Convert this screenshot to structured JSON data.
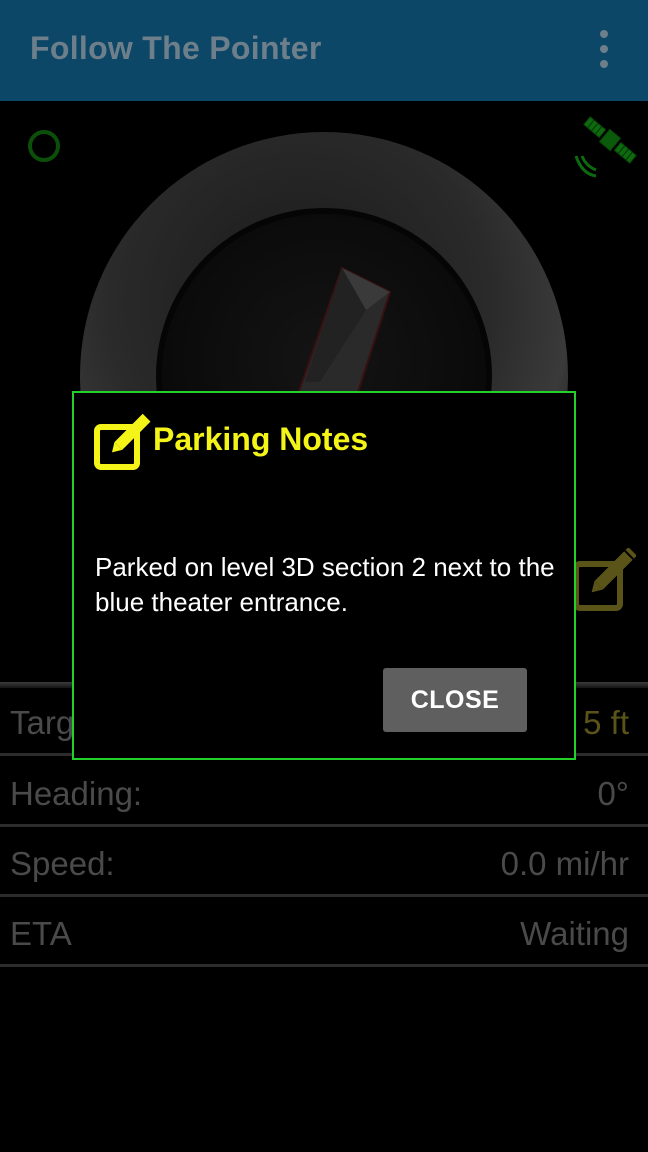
{
  "app_bar": {
    "title": "Follow The Pointer",
    "menu_icon": "overflow-menu-icon"
  },
  "status": {
    "gps_status_icon": "gps-signal-ring-icon",
    "satellite_icon": "satellite-icon",
    "edit_notes_icon": "edit-notes-icon"
  },
  "info_rows": [
    {
      "label": "Targ",
      "value": "5 ft"
    },
    {
      "label": "Heading:",
      "value": "0°"
    },
    {
      "label": "Speed:",
      "value": "0.0 mi/hr"
    },
    {
      "label": "ETA",
      "value": "Waiting"
    }
  ],
  "dialog": {
    "title": "Parking Notes",
    "icon": "edit-icon",
    "message": "Parked on level 3D section 2 next to the blue theater entrance.",
    "close_label": "CLOSE"
  },
  "colors": {
    "app_bar": "#0d4767",
    "dialog_border": "#22d22a",
    "dialog_title": "#f4f418",
    "button": "#5f5f5f"
  }
}
